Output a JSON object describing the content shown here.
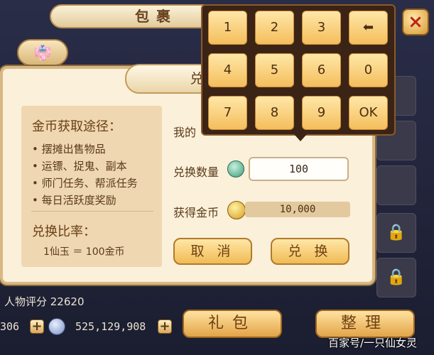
{
  "inventory": {
    "title": "包裹",
    "close_icon": "×",
    "score_label": "人物评分 22620",
    "gem_count": "306",
    "gold_count": "525,129,908",
    "gift_button": "礼包",
    "sort_button": "整理"
  },
  "dialog": {
    "title": "兑换金",
    "info_title": "金币获取途径：",
    "info_items": [
      "• 摆摊出售物品",
      "• 运镖、捉鬼、副本",
      "• 师门任务、帮派任务",
      "• 每日活跃度奖励"
    ],
    "rate_title": "兑换比率：",
    "rate_text": "1仙玉 ＝ 100金币",
    "my_label": "我的",
    "qty_label": "兑换数量",
    "qty_value": "100",
    "gain_label": "获得金币",
    "gain_value": "10,000",
    "cancel_label": "取 消",
    "confirm_label": "兑 换"
  },
  "numpad": {
    "keys": [
      "1",
      "2",
      "3",
      "⬅",
      "4",
      "5",
      "6",
      "0",
      "7",
      "8",
      "9",
      "OK"
    ]
  },
  "watermark": "百家号/一只仙女灵",
  "colors": {
    "panel": "#fbf0da",
    "button": "#f0bb55",
    "numpad_bg": "#3b2415",
    "close_x": "#c0221a"
  },
  "icons": [
    "close-icon",
    "backspace-icon",
    "jade-icon",
    "gold-coin-icon",
    "lock-icon"
  ]
}
